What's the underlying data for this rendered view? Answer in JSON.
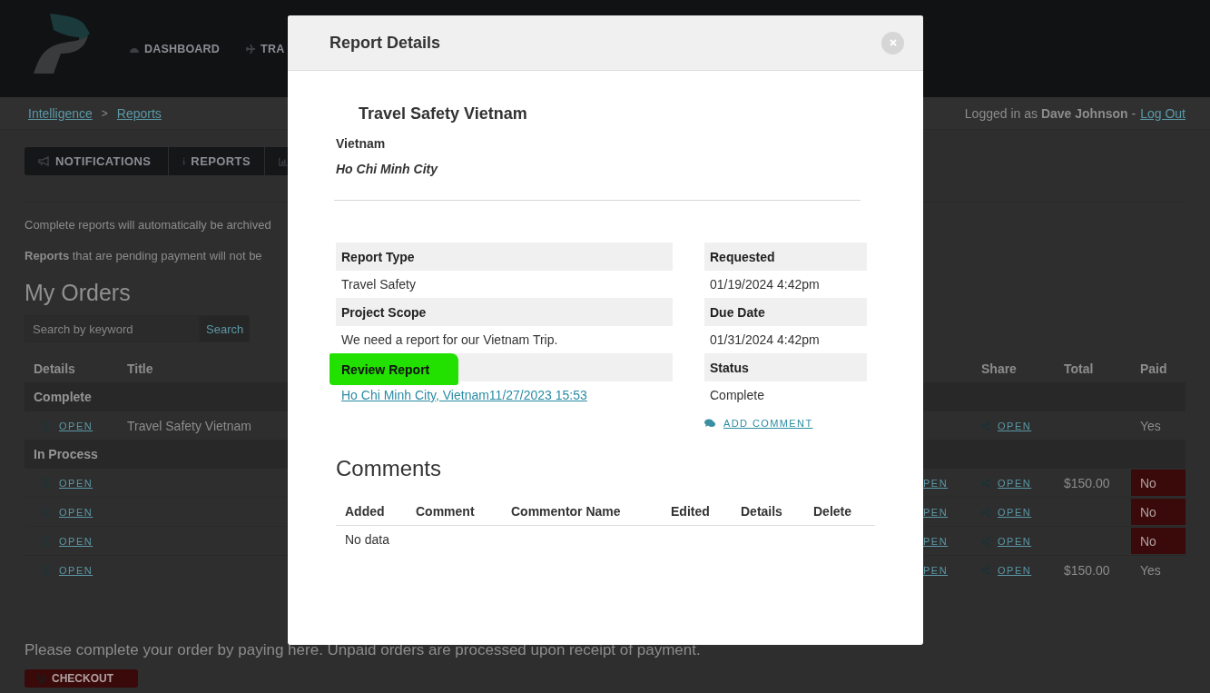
{
  "header": {
    "nav": [
      {
        "label": "DASHBOARD"
      },
      {
        "label": "TRA"
      }
    ]
  },
  "breadcrumb": {
    "items": [
      "Intelligence",
      "Reports"
    ],
    "separator": ">"
  },
  "user": {
    "text": "Logged in as **Dave Johnson** -",
    "logout": "Log Out"
  },
  "tabs": [
    {
      "label": "NOTIFICATIONS",
      "kind": "text"
    },
    {
      "label": "REPORTS",
      "kind": "text"
    },
    {
      "kind": "icon"
    }
  ],
  "notices": [
    "Complete reports will automatically be archived",
    "**Reports** that are pending payment will not be"
  ],
  "orders": {
    "title": "My Orders",
    "search": {
      "placeholder": "Search by keyword",
      "button": "Search"
    },
    "columns": [
      "Details",
      "Title",
      "Share",
      "Total",
      "Paid"
    ],
    "groups": [
      {
        "label": "Complete",
        "rows": [
          {
            "open": "OPEN",
            "title": "Travel Safety Vietnam",
            "share": "OPEN",
            "paid": "Yes",
            "unpaid": false
          }
        ]
      },
      {
        "label": "In Process",
        "rows": [
          {
            "open": "OPEN",
            "column_3": "PEN",
            "share": "OPEN",
            "total": "$150.00",
            "paid": "No",
            "unpaid": true
          },
          {
            "open": "OPEN",
            "column_3": "PEN",
            "share": "OPEN",
            "paid": "No",
            "unpaid": true
          },
          {
            "open": "OPEN",
            "column_3": "PEN",
            "share": "OPEN",
            "paid": "No",
            "unpaid": true
          },
          {
            "open": "OPEN",
            "column_3": "PEN",
            "share": "OPEN",
            "total": "$150.00",
            "paid": "Yes",
            "unpaid": false
          }
        ]
      }
    ]
  },
  "payment_note": "Please complete your order by paying here. Unpaid orders are processed upon receipt of payment.",
  "checkout": {
    "label": "CHECKOUT"
  },
  "modal": {
    "title": "Report Details",
    "report_title": "Travel Safety Vietnam",
    "country": "Vietnam",
    "city": "Ho Chi Minh City",
    "left": [
      {
        "label": "Report Type",
        "value": "Travel Safety",
        "kind": "text",
        "highlighted": false
      },
      {
        "label": "Project Scope",
        "value": "We need a report for our Vietnam Trip.",
        "kind": "text",
        "highlighted": false
      },
      {
        "label": "Review Report",
        "value": "Ho Chi Minh City, Vietnam11/27/2023 15:53",
        "kind": "link",
        "highlighted": true
      }
    ],
    "right": [
      {
        "label": "Requested",
        "value": "01/19/2024 4:42pm"
      },
      {
        "label": "Due Date",
        "value": "01/31/2024 4:42pm"
      },
      {
        "label": "Status",
        "value": "Complete"
      }
    ],
    "add_comment": "ADD COMMENT",
    "comments": {
      "title": "Comments",
      "columns": [
        "Added",
        "Comment",
        "Commentor Name",
        "Edited",
        "Details",
        "Delete"
      ],
      "empty": "No data"
    }
  }
}
